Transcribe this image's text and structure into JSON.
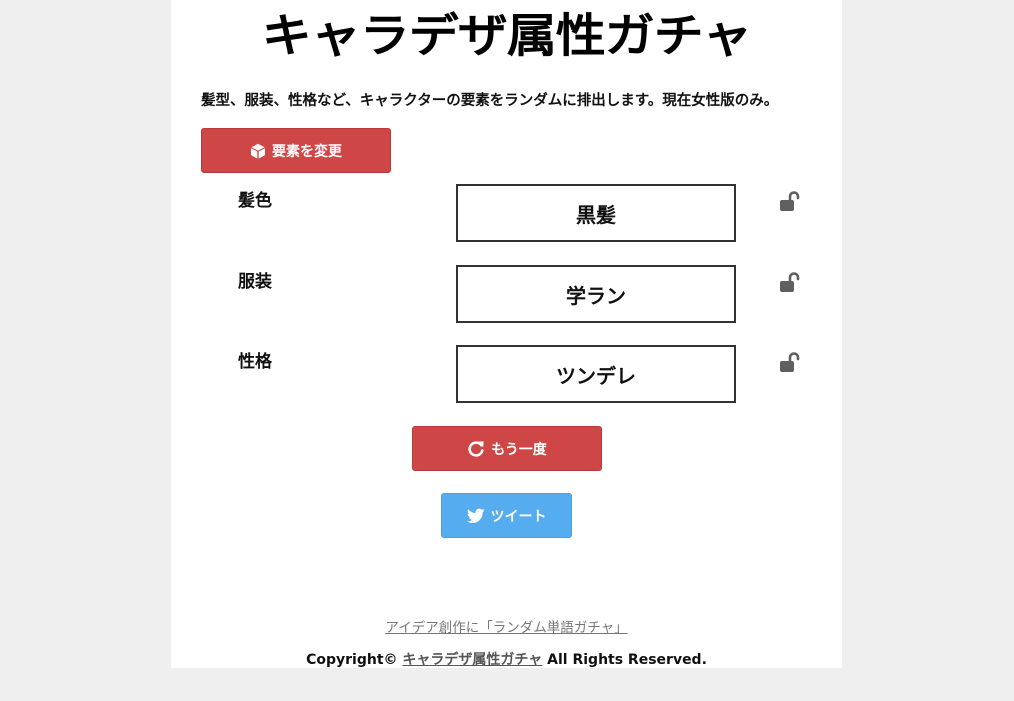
{
  "site_title": "キャラデザ属性ガチャ",
  "description": "髪型、服装、性格など、キャラクターの要素をランダムに排出します。現在女性版のみ。",
  "buttons": {
    "change_label": "要素を変更",
    "retry_label": "もう一度",
    "tweet_label": "ツイート"
  },
  "attributes": [
    {
      "label": "髪色",
      "value": "黒髪"
    },
    {
      "label": "服装",
      "value": "学ラン"
    },
    {
      "label": "性格",
      "value": "ツンデレ"
    }
  ],
  "footer": {
    "related_link": "アイデア創作に「ランダム単語ガチャ」",
    "copyright_prefix": "Copyright©",
    "copyright_brand": "キャラデザ属性ガチャ",
    "copyright_suffix": "All Rights Reserved."
  },
  "icons": {
    "change": "cube-icon",
    "retry": "redo-icon",
    "tweet": "twitter-bird-icon",
    "lock": "unlocked-padlock-icon"
  },
  "colors": {
    "primary_button": "#cf4647",
    "tweet_button": "#55acee",
    "page_background": "#efefef",
    "content_background": "#ffffff"
  }
}
